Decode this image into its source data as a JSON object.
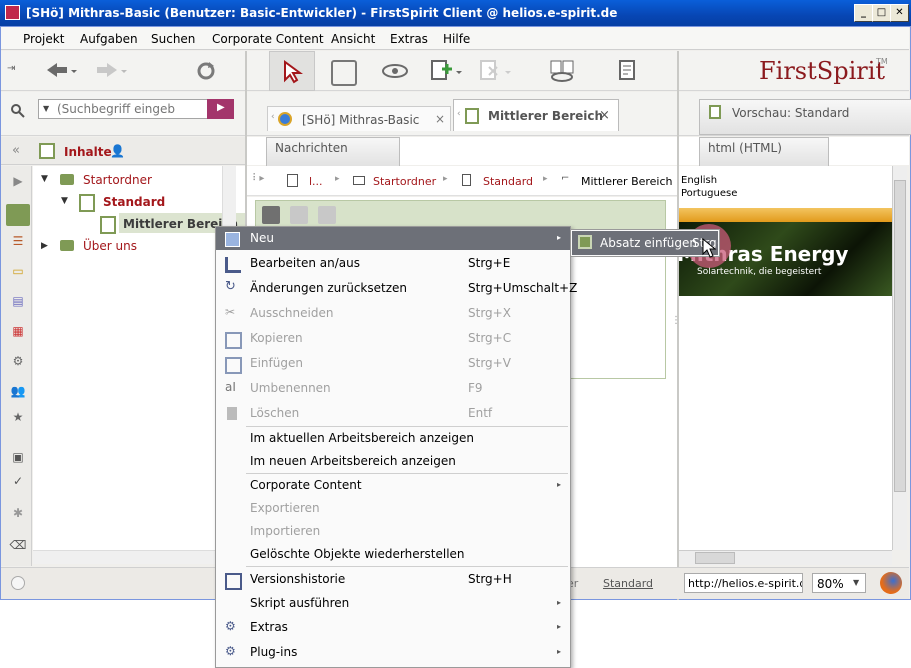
{
  "window": {
    "title": "[SHö] Mithras-Basic (Benutzer: Basic-Entwickler) - FirstSpirit Client @ helios.e-spirit.de",
    "min": "_",
    "max": "□",
    "close": "✕"
  },
  "menubar": [
    "Projekt",
    "Aufgaben",
    "Suchen",
    "Corporate Content",
    "Ansicht",
    "Extras",
    "Hilfe"
  ],
  "brand": {
    "logo": "FirstSpirit",
    "tm": "TM"
  },
  "search": {
    "placeholder": "(Suchbegriff eingeb"
  },
  "tabs": [
    {
      "label": "[SHö] Mithras-Basic",
      "close": "×"
    },
    {
      "label": "Mittlerer Bereich",
      "close": "×"
    }
  ],
  "preview_tab": "Vorschau: Standard",
  "sub_buttons": {
    "messages": "Nachrichten",
    "html": "html (HTML)"
  },
  "sidebar": {
    "header": "Inhalte"
  },
  "tree": [
    {
      "label": "Startordner"
    },
    {
      "label": "Standard"
    },
    {
      "label": "Mittlerer Bereich"
    },
    {
      "label": "Über uns"
    }
  ],
  "breadcrumb": [
    "l...",
    "Startordner",
    "Standard",
    "Mittlerer Bereich"
  ],
  "preview": {
    "lang1": "English",
    "lang2": "Portuguese",
    "banner_title": "Mithras Energy",
    "banner_sub": "Solartechnik, die begeistert"
  },
  "statusbar": {
    "url": "http://helios.e-spirit.de:8",
    "zoom": "80%",
    "link_partial": "er",
    "link": "Standard"
  },
  "context_menu": [
    {
      "label": "Neu",
      "shortcut": "",
      "submenu": true,
      "enabled": true,
      "icon": "new-icon"
    },
    {
      "label": "Bearbeiten an/aus",
      "shortcut": "Strg+E",
      "enabled": true,
      "icon": "edit-icon"
    },
    {
      "label": "Änderungen zurücksetzen",
      "shortcut": "Strg+Umschalt+Z",
      "enabled": true,
      "icon": "revert-icon"
    },
    {
      "label": "Ausschneiden",
      "shortcut": "Strg+X",
      "enabled": false,
      "icon": "cut-icon"
    },
    {
      "label": "Kopieren",
      "shortcut": "Strg+C",
      "enabled": false,
      "icon": "copy-icon"
    },
    {
      "label": "Einfügen",
      "shortcut": "Strg+V",
      "enabled": false,
      "icon": "paste-icon"
    },
    {
      "label": "Umbenennen",
      "shortcut": "F9",
      "enabled": false,
      "icon": "rename-icon"
    },
    {
      "label": "Löschen",
      "shortcut": "Entf",
      "enabled": false,
      "icon": "delete-icon"
    },
    {
      "label": "Im aktuellen Arbeitsbereich anzeigen",
      "shortcut": "",
      "enabled": true
    },
    {
      "label": "Im neuen Arbeitsbereich anzeigen",
      "shortcut": "",
      "enabled": true
    },
    {
      "label": "Corporate Content",
      "shortcut": "",
      "submenu": true,
      "enabled": true
    },
    {
      "label": "Exportieren",
      "shortcut": "",
      "enabled": false
    },
    {
      "label": "Importieren",
      "shortcut": "",
      "enabled": false
    },
    {
      "label": "Gelöschte Objekte wiederherstellen",
      "shortcut": "",
      "enabled": true
    },
    {
      "label": "Versionshistorie",
      "shortcut": "Strg+H",
      "enabled": true,
      "icon": "history-icon"
    },
    {
      "label": "Skript ausführen",
      "shortcut": "",
      "submenu": true,
      "enabled": true
    },
    {
      "label": "Extras",
      "shortcut": "",
      "submenu": true,
      "enabled": true,
      "icon": "gears-icon"
    },
    {
      "label": "Plug-ins",
      "shortcut": "",
      "submenu": true,
      "enabled": true,
      "icon": "plugin-icon"
    }
  ],
  "submenu": {
    "label": "Absatz einfügen",
    "shortcut": "Strg+N"
  },
  "colors": {
    "accent": "#a3171b",
    "menu_highlight": "#6d7078",
    "title_bar": "#0746b4"
  }
}
